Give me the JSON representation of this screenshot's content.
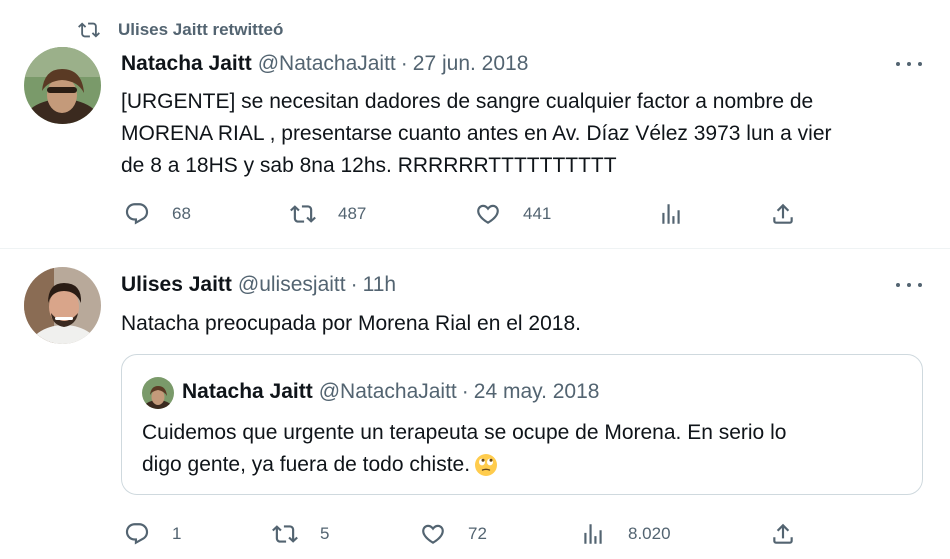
{
  "colors": {
    "text": "#0f1419",
    "muted": "#536471",
    "border": "#cfd9de",
    "divider": "#eff3f4"
  },
  "retweet": {
    "icon": "retweet-icon",
    "label": "Ulises Jaitt retwitteó"
  },
  "tweet1": {
    "name": "Natacha Jaitt",
    "handle": "@NatachaJaitt",
    "dot": "·",
    "time": "27 jun. 2018",
    "text_lines": [
      "[URGENTE] se necesitan dadores de sangre cualquier factor a nombre de",
      "MORENA RIAL , presentarse cuanto antes en Av. Díaz Vélez 3973 lun a vier",
      "de 8 a 18HS y sab 8na 12hs. RRRRRRTTTTTTTTTT"
    ],
    "replies": "68",
    "retweets": "487",
    "likes": "441",
    "views": "",
    "icons": [
      "reply-icon",
      "retweet-icon",
      "like-icon",
      "analytics-icon",
      "share-icon"
    ]
  },
  "tweet2": {
    "name": "Ulises Jaitt",
    "handle": "@ulisesjaitt",
    "dot": "·",
    "time": "11h",
    "text": "Natacha preocupada por Morena Rial en el 2018.",
    "quote": {
      "name": "Natacha Jaitt",
      "handle": "@NatachaJaitt",
      "dot": "·",
      "time": "24 may. 2018",
      "text_lines": [
        "Cuidemos que urgente un terapeuta se ocupe de Morena. En serio lo",
        "digo gente, ya fuera de todo chiste."
      ],
      "emoji": "face-with-rolling-eyes-emoji"
    },
    "replies": "1",
    "retweets": "5",
    "likes": "72",
    "views": "8.020"
  }
}
